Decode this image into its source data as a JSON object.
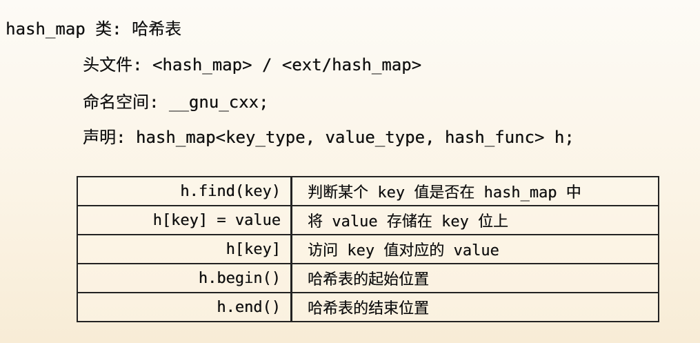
{
  "title": "hash_map 类: 哈希表",
  "header_line": "头文件: <hash_map> / <ext/hash_map>",
  "namespace_line": "命名空间: __gnu_cxx;",
  "declaration_line": "声明: hash_map<key_type, value_type, hash_func> h;",
  "table": {
    "rows": [
      {
        "operation": "h.find(key)",
        "description": "判断某个 key 值是否在 hash_map 中"
      },
      {
        "operation": "h[key] = value",
        "description": "将 value 存储在 key 位上"
      },
      {
        "operation": "h[key]",
        "description": "访问 key 值对应的 value"
      },
      {
        "operation": "h.begin()",
        "description": "哈希表的起始位置"
      },
      {
        "operation": "h.end()",
        "description": "哈希表的结束位置"
      }
    ]
  }
}
